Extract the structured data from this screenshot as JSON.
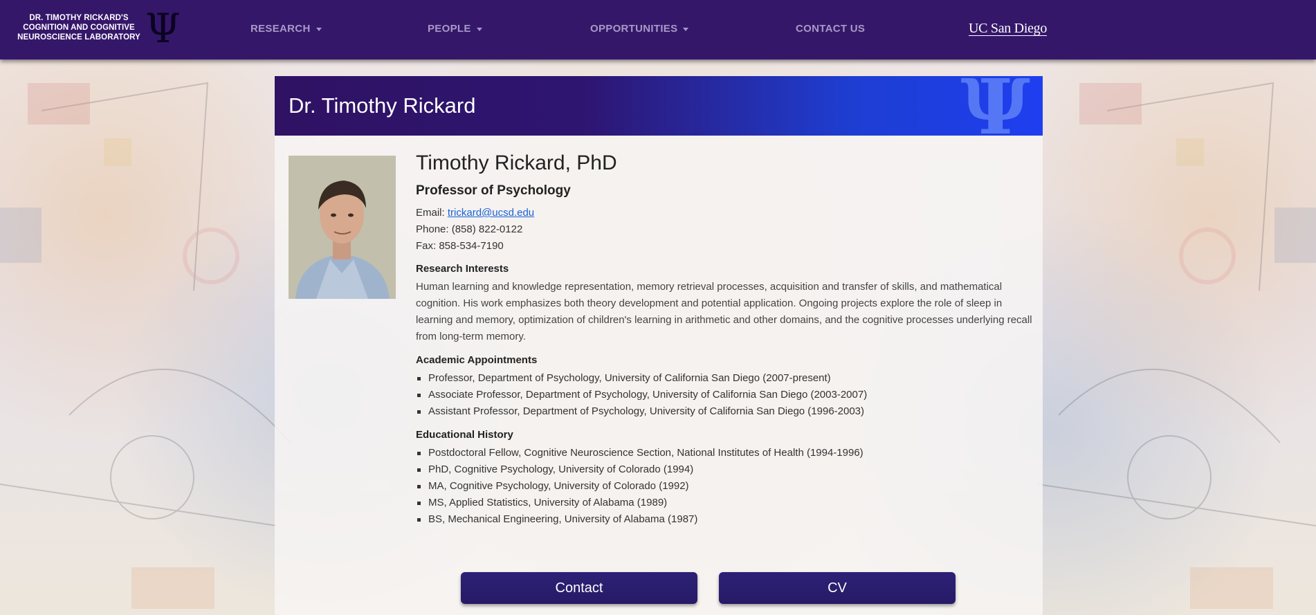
{
  "brand": {
    "line1": "DR. TIMOTHY RICKARD'S",
    "line2": "COGNITION AND COGNITIVE",
    "line3": "NEUROSCIENCE LABORATORY",
    "icon": "psi-icon"
  },
  "nav": {
    "research": "RESEARCH",
    "people": "PEOPLE",
    "opportunities": "OPPORTUNITIES",
    "contact": "CONTACT US",
    "ucsd": "UC San Diego"
  },
  "colors": {
    "navbar": "#35176a",
    "banner_start": "#2f1263",
    "banner_end": "#1f3ef0",
    "button": "#2a1e70",
    "link": "#1a63d6"
  },
  "banner": {
    "title": "Dr. Timothy Rickard"
  },
  "profile": {
    "name": "Timothy Rickard, PhD",
    "title": "Professor of Psychology",
    "email_label": "Email:",
    "email": "trickard@ucsd.edu",
    "phone": "Phone: (858) 822-0122",
    "fax": "Fax: 858-534-7190"
  },
  "research": {
    "heading": "Research Interests",
    "text": "Human learning and knowledge representation, memory retrieval processes, acquisition and transfer of skills, and mathematical cognition. His work emphasizes both theory development and potential application. Ongoing projects explore the role of sleep in learning and memory, optimization of children's learning in arithmetic and other domains, and the cognitive processes underlying recall from long-term memory."
  },
  "appointments": {
    "heading": "Academic Appointments",
    "items": [
      "Professor, Department of Psychology, University of California San Diego (2007-present)",
      "Associate Professor, Department of Psychology, University of California San Diego (2003-2007)",
      "Assistant Professor, Department of Psychology, University of California San Diego (1996-2003)"
    ]
  },
  "education": {
    "heading": "Educational History",
    "items": [
      "Postdoctoral Fellow, Cognitive Neuroscience Section, National Institutes of Health (1994-1996)",
      "PhD, Cognitive Psychology, University of Colorado (1994)",
      "MA, Cognitive Psychology, University of Colorado (1992)",
      "MS, Applied Statistics, University of Alabama (1989)",
      "BS, Mechanical Engineering, University of Alabama (1987)"
    ]
  },
  "buttons": {
    "contact": "Contact",
    "cv": "CV"
  }
}
